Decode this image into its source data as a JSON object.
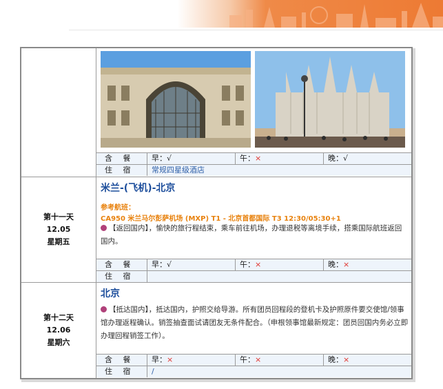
{
  "colors": {
    "accent_blue": "#1d4e9c",
    "accent_orange": "#e8820e",
    "x_red": "#e0322d",
    "header_orange": "#ed7a33"
  },
  "day_top": {
    "photos": [
      {
        "name": "galleria-photo",
        "subject": "arcade facade"
      },
      {
        "name": "cathedral-photo",
        "subject": "gothic cathedral square"
      }
    ],
    "meal_label": "含  餐",
    "breakfast": "早：√",
    "lunch_prefix": "午：",
    "lunch_mark": "×",
    "dinner": "晚：√",
    "hotel_label": "住  宿",
    "hotel": "常规四星级酒店"
  },
  "day11": {
    "day": "第十一天",
    "date": "12.05",
    "weekday": "星期五",
    "title": "米兰-(飞机)-北京",
    "flight_label": "参考航班：",
    "flight": "CA950  米兰马尔彭萨机场 (MXP) T1 - 北京首都国际 T3  12:30/05:30+1",
    "desc_tag": "【返回国内】",
    "desc": "，愉快的旅行程结束，乘车前往机场，办理退税等离境手续，搭乘国际航班返回国内。",
    "meal_label": "含  餐",
    "breakfast": "早：√",
    "lunch_prefix": "午：",
    "lunch_mark": "×",
    "dinner_prefix": "晚：",
    "dinner_mark": "×",
    "hotel_label": "住  宿",
    "hotel": ""
  },
  "day12": {
    "day": "第十二天",
    "date": "12.06",
    "weekday": "星期六",
    "title": "北京",
    "desc_tag": "【抵达国内】",
    "desc": "，抵达国内，护照交给导游。所有团员回程段的登机卡及护照原件要交使馆/领事馆办理返程确认。销签抽查面试请团友无条件配合。（申根领事馆最新规定：团员回国内务必立即办理回程销签工作）。",
    "meal_label": "含  餐",
    "breakfast_prefix": "早：",
    "breakfast_mark": "×",
    "lunch_prefix": "午：",
    "lunch_mark": "×",
    "dinner_prefix": "晚：",
    "dinner_mark": "×",
    "hotel_label": "住  宿",
    "hotel": "/"
  }
}
